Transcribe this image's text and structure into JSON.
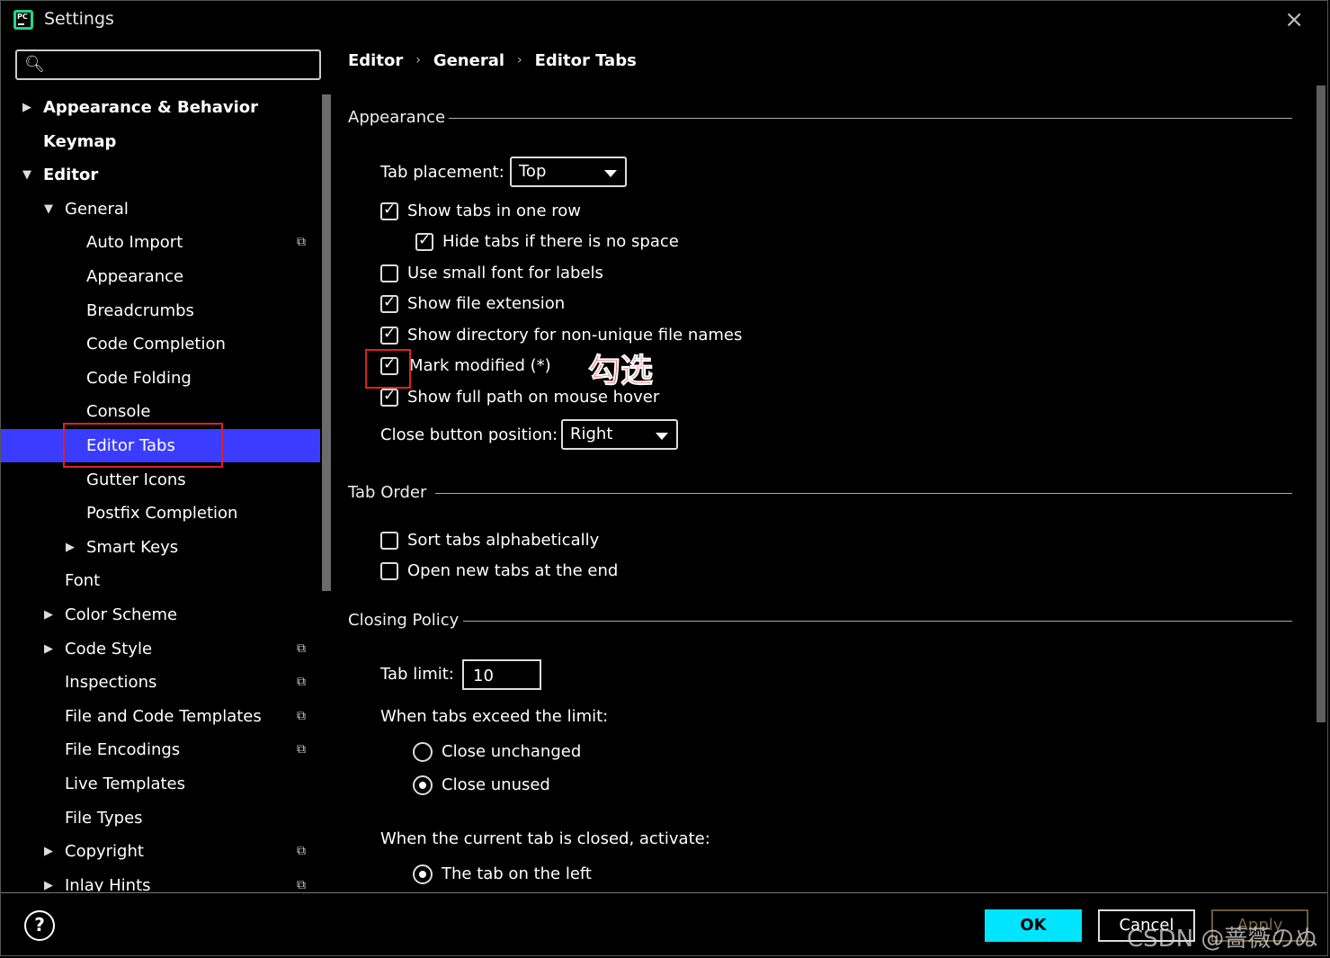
{
  "window": {
    "title": "Settings",
    "close_icon": "×"
  },
  "search": {
    "value": "",
    "placeholder": ""
  },
  "breadcrumb": [
    "Editor",
    "General",
    "Editor Tabs"
  ],
  "tree": [
    {
      "label": "Appearance & Behavior",
      "arrow": "▶",
      "bold": true
    },
    {
      "label": "Keymap",
      "arrow": "",
      "bold": true
    },
    {
      "label": "Editor",
      "arrow": "▼",
      "bold": true
    },
    {
      "label": "General",
      "arrow": "▼",
      "bold": false
    },
    {
      "label": "Auto Import",
      "arrow": "",
      "bold": false,
      "project": true
    },
    {
      "label": "Appearance",
      "arrow": "",
      "bold": false
    },
    {
      "label": "Breadcrumbs",
      "arrow": "",
      "bold": false
    },
    {
      "label": "Code Completion",
      "arrow": "",
      "bold": false
    },
    {
      "label": "Code Folding",
      "arrow": "",
      "bold": false
    },
    {
      "label": "Console",
      "arrow": "",
      "bold": false
    },
    {
      "label": "Editor Tabs",
      "arrow": "",
      "bold": false,
      "selected": true
    },
    {
      "label": "Gutter Icons",
      "arrow": "",
      "bold": false
    },
    {
      "label": "Postfix Completion",
      "arrow": "",
      "bold": false
    },
    {
      "label": "Smart Keys",
      "arrow": "▶",
      "bold": false
    },
    {
      "label": "Font",
      "arrow": "",
      "bold": false
    },
    {
      "label": "Color Scheme",
      "arrow": "▶",
      "bold": false
    },
    {
      "label": "Code Style",
      "arrow": "▶",
      "bold": false,
      "project": true
    },
    {
      "label": "Inspections",
      "arrow": "",
      "bold": false,
      "project": true
    },
    {
      "label": "File and Code Templates",
      "arrow": "",
      "bold": false,
      "project": true
    },
    {
      "label": "File Encodings",
      "arrow": "",
      "bold": false,
      "project": true
    },
    {
      "label": "Live Templates",
      "arrow": "",
      "bold": false
    },
    {
      "label": "File Types",
      "arrow": "",
      "bold": false
    },
    {
      "label": "Copyright",
      "arrow": "▶",
      "bold": false,
      "project": true
    },
    {
      "label": "Inlay Hints",
      "arrow": "▶",
      "bold": false,
      "project": true
    }
  ],
  "project_icon": "⧉",
  "appearance": {
    "title": "Appearance",
    "tab_placement_label": "Tab placement:",
    "tab_placement_value": "Top",
    "checkboxes": [
      {
        "label": "Show tabs in one row",
        "checked": true
      },
      {
        "label": "Hide tabs if there is no space",
        "checked": true
      },
      {
        "label": "Use small font for labels",
        "checked": false
      },
      {
        "label": "Show file extension",
        "checked": true
      },
      {
        "label": "Show directory for non-unique file names",
        "checked": true
      },
      {
        "label": "Mark modified (*)",
        "checked": true
      },
      {
        "label": "Show full path on mouse hover",
        "checked": true
      }
    ],
    "close_button_label": "Close button position:",
    "close_button_value": "Right"
  },
  "tab_order": {
    "title": "Tab Order",
    "checkboxes": [
      {
        "label": "Sort tabs alphabetically",
        "checked": false
      },
      {
        "label": "Open new tabs at the end",
        "checked": false
      }
    ]
  },
  "closing_policy": {
    "title": "Closing Policy",
    "tab_limit_label": "Tab limit:",
    "tab_limit_value": "10",
    "exceed_label": "When tabs exceed the limit:",
    "exceed_options": [
      {
        "label": "Close unchanged",
        "selected": false
      },
      {
        "label": "Close unused",
        "selected": true
      }
    ],
    "activate_label": "When the current tab is closed, activate:",
    "activate_options": [
      {
        "label": "The tab on the left",
        "selected": true
      }
    ]
  },
  "annotation": {
    "text": "勾选",
    "color": "#ff3030"
  },
  "buttons": {
    "help": "?",
    "ok": "OK",
    "cancel": "Cancel",
    "apply": "Apply"
  },
  "watermark": "CSDN @蔷薇のぬ",
  "colors": {
    "selection": "#3a3dff",
    "ok_button": "#00e5ff",
    "annotation_red": "#e02020"
  }
}
